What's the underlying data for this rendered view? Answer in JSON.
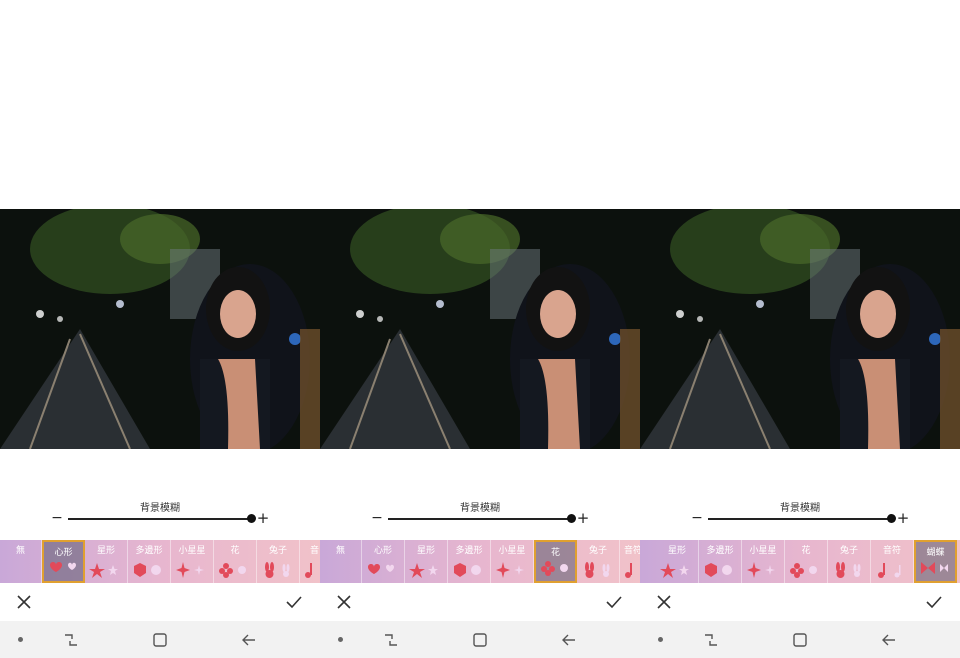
{
  "slider": {
    "label": "背景模糊",
    "minus": "−",
    "plus": "+"
  },
  "panels": [
    {
      "selected": "心形",
      "tiles": [
        "無",
        "心形",
        "星形",
        "多邊形",
        "小星星",
        "花",
        "兔子",
        "音"
      ]
    },
    {
      "selected": "花",
      "tiles": [
        "無",
        "心形",
        "星形",
        "多邊形",
        "小星星",
        "花",
        "兔子",
        "音符"
      ]
    },
    {
      "selected": "蝴蝶",
      "tiles": [
        "星形",
        "多邊形",
        "小星星",
        "花",
        "兔子",
        "音符",
        "蝴蝶"
      ]
    }
  ],
  "icons": {
    "cancel": "close-icon",
    "confirm": "check-icon",
    "nav": [
      "dot-icon",
      "recent-apps-icon",
      "home-icon",
      "back-icon"
    ]
  }
}
